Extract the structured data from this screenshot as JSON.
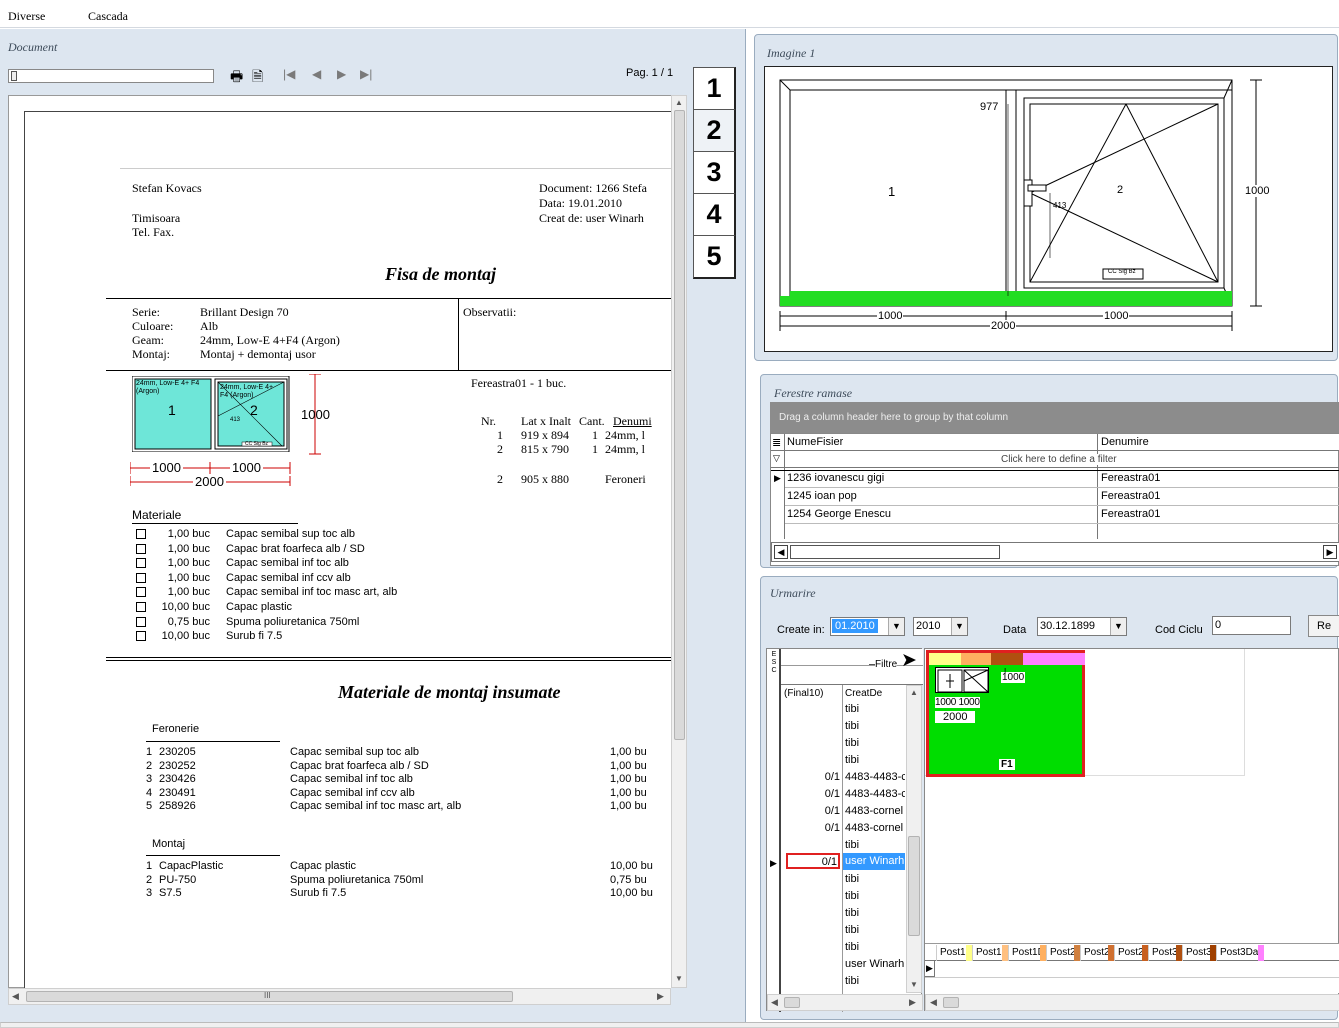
{
  "menu": {
    "items": [
      "Diverse",
      "Cascada"
    ]
  },
  "document": {
    "title": "Document",
    "page": "Pag. 1 / 1",
    "tabs": [
      "1",
      "2",
      "3",
      "4",
      "5"
    ],
    "header": {
      "name": "Stefan Kovacs",
      "city": "Timisoara",
      "tel": "Tel. Fax.",
      "doc": "Document: 1266 Stefa",
      "data": "Data: 19.01.2010",
      "creat": "Creat de: user Winarh"
    },
    "heading1": "Fisa de montaj",
    "specs": [
      {
        "k": "Serie:",
        "v": "Brillant Design 70"
      },
      {
        "k": "Culoare:",
        "v": "Alb"
      },
      {
        "k": "Geam:",
        "v": "24mm, Low-E 4+F4 (Argon)"
      },
      {
        "k": "Montaj:",
        "v": "Montaj + demontaj usor"
      }
    ],
    "observatii": "Observatii:",
    "window_title": "Fereastra01 - 1 buc.",
    "dims_head": {
      "nr": "Nr.",
      "dim": "Lat x Inalt",
      "cant": "Cant.",
      "den": "Denumi"
    },
    "dims_rows": [
      {
        "nr": "1",
        "dim": "919 x  894",
        "cant": "1",
        "den": "24mm, l"
      },
      {
        "nr": "2",
        "dim": "815 x  790",
        "cant": "1",
        "den": "24mm, l"
      },
      {
        "nr": "2",
        "dim": "905 x  880",
        "cant": "",
        "den": "Feroneri"
      }
    ],
    "thumb": {
      "pane1": "24mm, Low-E 4+ F4 (Argon)",
      "pane2": "24mm, Low-E 4+ F4 (Argon)",
      "h": "1000",
      "w1": "1000",
      "w2": "1000",
      "wt": "2000",
      "cc": "CC Sig Bz",
      "v413": "413"
    },
    "materiale_title": "Materiale",
    "materiale": [
      {
        "q": "1,00 buc",
        "d": "Capac semibal sup toc alb"
      },
      {
        "q": "1,00 buc",
        "d": "Capac brat foarfeca alb / SD"
      },
      {
        "q": "1,00 buc",
        "d": "Capac semibal inf toc alb"
      },
      {
        "q": "1,00 buc",
        "d": "Capac semibal inf ccv alb"
      },
      {
        "q": "1,00 buc",
        "d": "Capac semibal inf toc masc art, alb"
      },
      {
        "q": "10,00 buc",
        "d": "Capac plastic"
      },
      {
        "q": "0,75 buc",
        "d": "Spuma poliuretanica 750ml"
      },
      {
        "q": "10,00 buc",
        "d": "Surub fi 7.5"
      }
    ],
    "heading2": "Materiale de montaj insumate",
    "feronerie_title": "Feronerie",
    "feronerie": [
      {
        "n": "1",
        "c": "230205",
        "d": "Capac semibal sup toc alb",
        "q": "1,00 bu"
      },
      {
        "n": "2",
        "c": "230252",
        "d": "Capac brat foarfeca alb / SD",
        "q": "1,00 bu"
      },
      {
        "n": "3",
        "c": "230426",
        "d": "Capac semibal inf toc alb",
        "q": "1,00 bu"
      },
      {
        "n": "4",
        "c": "230491",
        "d": "Capac semibal inf ccv alb",
        "q": "1,00 bu"
      },
      {
        "n": "5",
        "c": "258926",
        "d": "Capac semibal inf toc masc art, alb",
        "q": "1,00 bu"
      }
    ],
    "montaj_title": "Montaj",
    "montaj": [
      {
        "n": "1",
        "c": "CapacPlastic",
        "d": "Capac plastic",
        "q": "10,00 bu"
      },
      {
        "n": "2",
        "c": "PU-750",
        "d": "Spuma poliuretanica 750ml",
        "q": "0,75 bu"
      },
      {
        "n": "3",
        "c": "S7.5",
        "d": "Surub fi 7.5",
        "q": "10,00 bu"
      }
    ],
    "hscroll_grip": "III"
  },
  "imagine": {
    "title": "Imagine 1",
    "h977": "977",
    "h1000": "1000",
    "w1000a": "1000",
    "w1000b": "1000",
    "w2000": "2000",
    "sash1": "1",
    "sash2": "2",
    "v413": "413",
    "cc": "CC Sig Bz"
  },
  "ferestre": {
    "title": "Ferestre ramase",
    "group_hint": "Drag a column header here to group by that column",
    "col1": "NumeFisier",
    "col2": "Denumire",
    "filter_hint": "Click here to define a filter",
    "rows": [
      {
        "a": "1236 iovanescu gigi",
        "b": "Fereastra01"
      },
      {
        "a": "1245 ioan pop",
        "b": "Fereastra01"
      },
      {
        "a": "1254 George Enescu",
        "b": "Fereastra01"
      }
    ]
  },
  "urmarire": {
    "title": "Urmarire",
    "create_label": "Create in:",
    "create_month": "01.2010",
    "create_year": "2010",
    "data_label": "Data",
    "data_value": "30.12.1899",
    "cod_label": "Cod Ciclu",
    "cod_value": "0",
    "re_btn": "Re",
    "esc": "E S C",
    "filter_btn": "Filtre",
    "col_final": "(Final10)",
    "col_creat": "CreatDe",
    "rows": [
      {
        "f": "",
        "c": "tibi"
      },
      {
        "f": "",
        "c": "tibi"
      },
      {
        "f": "",
        "c": "tibi"
      },
      {
        "f": "",
        "c": "tibi"
      },
      {
        "f": "0/1",
        "c": "4483-4483-c"
      },
      {
        "f": "0/1",
        "c": "4483-4483-c"
      },
      {
        "f": "0/1",
        "c": "4483-cornel"
      },
      {
        "f": "0/1",
        "c": "4483-cornel"
      },
      {
        "f": "",
        "c": "tibi"
      },
      {
        "f": "0/1",
        "c": "user Winarh"
      },
      {
        "f": "",
        "c": "tibi"
      },
      {
        "f": "",
        "c": "tibi"
      },
      {
        "f": "",
        "c": "tibi"
      },
      {
        "f": "",
        "c": "tibi"
      },
      {
        "f": "",
        "c": "tibi"
      },
      {
        "f": "",
        "c": "user Winarh"
      },
      {
        "f": "",
        "c": "tibi"
      }
    ],
    "card": {
      "w1": "1000",
      "w2": "1000",
      "wt": "2000",
      "h": "1000",
      "label": "F1"
    },
    "posts": [
      "Post1",
      "Post1!",
      "Post1D.",
      "Post2",
      "Post2",
      "Post2",
      "Post3",
      "Post3!",
      "Post3Data"
    ],
    "post_colors": [
      "#ffff88",
      "#ffc080",
      "#ffb060",
      "#d08040",
      "#d07030",
      "#c86020",
      "#b05010",
      "#a04000",
      "#ff80ff"
    ]
  }
}
